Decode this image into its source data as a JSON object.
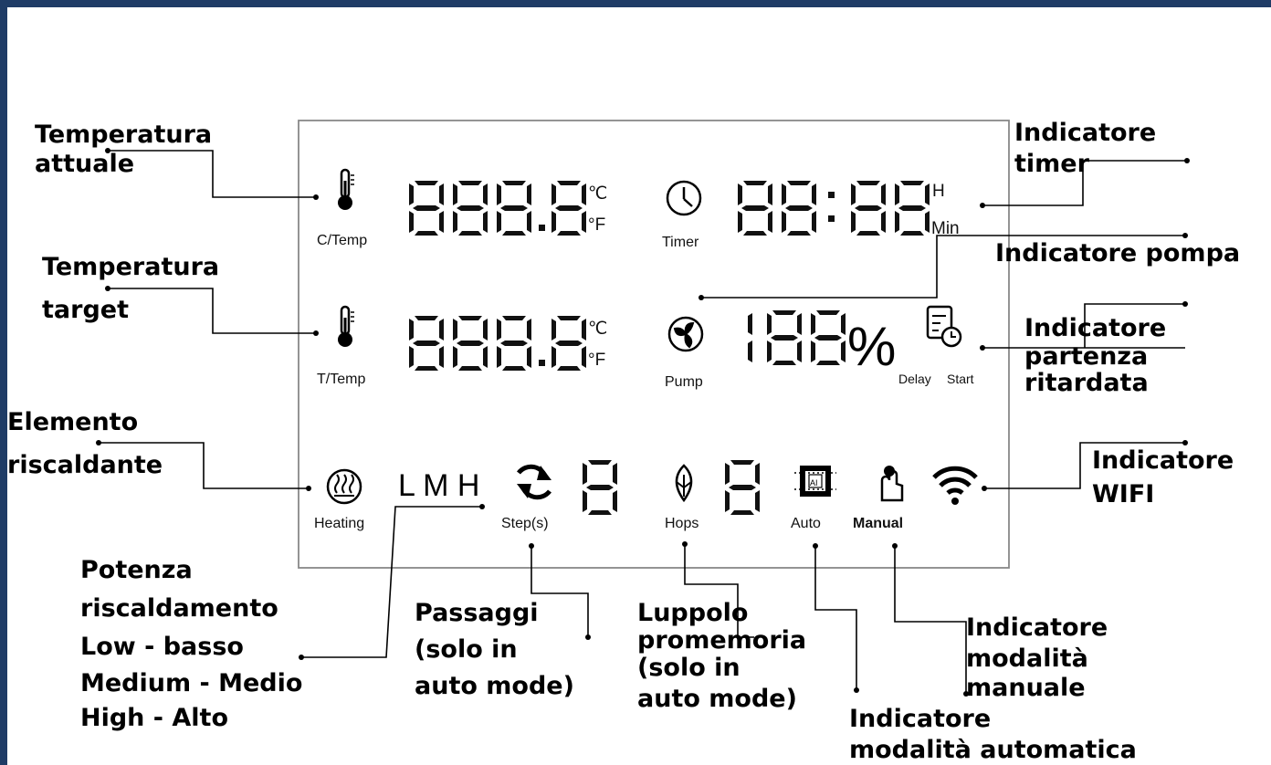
{
  "labels": {
    "temp_actual": [
      "Temperatura",
      "attuale"
    ],
    "temp_target": [
      "Temperatura",
      "target"
    ],
    "heating_element": [
      "Elemento",
      "riscaldante"
    ],
    "heating_power": [
      "Potenza",
      "riscaldamento",
      "Low - basso",
      "Medium - Medio",
      "High - Alto"
    ],
    "steps": [
      "Passaggi",
      "(solo in",
      "auto mode)"
    ],
    "hops_reminder": [
      "Luppolo",
      "promemoria",
      "(solo in",
      "auto mode)"
    ],
    "auto_mode": [
      "Indicatore",
      "modalità automatica"
    ],
    "manual_mode": [
      "Indicatore",
      "modalità",
      "manuale"
    ],
    "wifi": [
      "Indicatore",
      "WIFI"
    ],
    "delay_start": [
      "Indicatore",
      "partenza",
      "ritardata"
    ],
    "pump": [
      "Indicatore pompa"
    ],
    "timer": [
      "Indicatore",
      "timer"
    ]
  },
  "display": {
    "c_temp": "C/Temp",
    "t_temp": "T/Temp",
    "unit_c": "℃",
    "unit_f": "°F",
    "timer": "Timer",
    "unit_h": "H",
    "unit_min": "Min",
    "pump": "Pump",
    "percent": "%",
    "delay": "Delay",
    "start": "Start",
    "heating": "Heating",
    "lmh": "L M H",
    "steps": "Step(s)",
    "hops": "Hops",
    "auto": "Auto",
    "manual": "Manual",
    "ai": "AI"
  },
  "icons": [
    "thermometer-icon",
    "clock-icon",
    "pump-fan-icon",
    "delay-start-icon",
    "heating-coil-icon",
    "refresh-icon",
    "hops-icon",
    "ai-chip-icon",
    "hand-touch-icon",
    "wifi-icon"
  ],
  "colors": {
    "frame": "#1f3c66"
  }
}
